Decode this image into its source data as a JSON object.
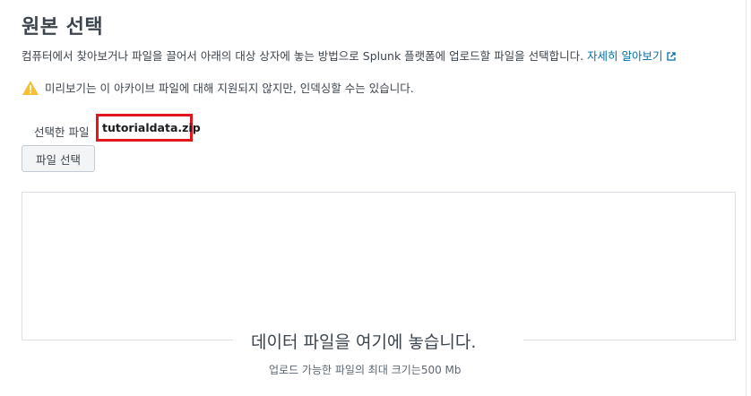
{
  "page": {
    "title": "원본 선택",
    "description": "컴퓨터에서 찾아보거나 파일을 끌어서 아래의 대상 상자에 놓는 방법으로 Splunk 플랫폼에 업로드할 파일을 선택합니다.",
    "learn_more_label": "자세히 알아보기",
    "learn_more_icon": "external-link-icon"
  },
  "warning": {
    "icon": "warning-triangle-icon",
    "color": "#f8be34",
    "text": "미리보기는 이 아카이브 파일에 대해 지원되지 않지만, 인덱싱할 수는 있습니다."
  },
  "file_selection": {
    "label": "선택한 파일",
    "file_name": "tutorialdata.zip",
    "highlight_color": "#e0151d",
    "button_label": "파일 선택"
  },
  "dropzone": {
    "title": "데이터 파일을 여기에 놓습니다.",
    "subtitle": "업로드 가능한 파일의 최대 크기는500 Mb"
  }
}
